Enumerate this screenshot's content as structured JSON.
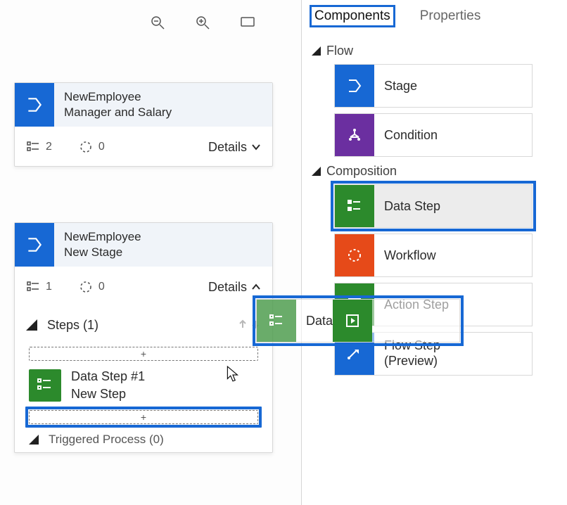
{
  "canvas": {
    "stages": [
      {
        "entity": "NewEmployee",
        "title": "Manager and Salary",
        "steps_count": "2",
        "workflows_count": "0",
        "details_label": "Details",
        "expanded": false
      },
      {
        "entity": "NewEmployee",
        "title": "New Stage",
        "steps_count": "1",
        "workflows_count": "0",
        "details_label": "Details",
        "expanded": true,
        "steps_header": "Steps (1)",
        "step1_title": "Data Step #1",
        "step1_sub": "New Step",
        "triggered_label": "Triggered Process (0)",
        "drop_plus": "+"
      }
    ]
  },
  "side": {
    "tab_components": "Components",
    "tab_properties": "Properties",
    "section_flow": "Flow",
    "section_composition": "Composition",
    "comp_stage": "Stage",
    "comp_condition": "Condition",
    "comp_data_step": "Data Step",
    "comp_workflow": "Workflow",
    "comp_action_step": "Action Step",
    "comp_flow_step_l1": "Flow Step",
    "comp_flow_step_l2": "(Preview)"
  },
  "drag": {
    "ghost_label": "Data Step"
  }
}
